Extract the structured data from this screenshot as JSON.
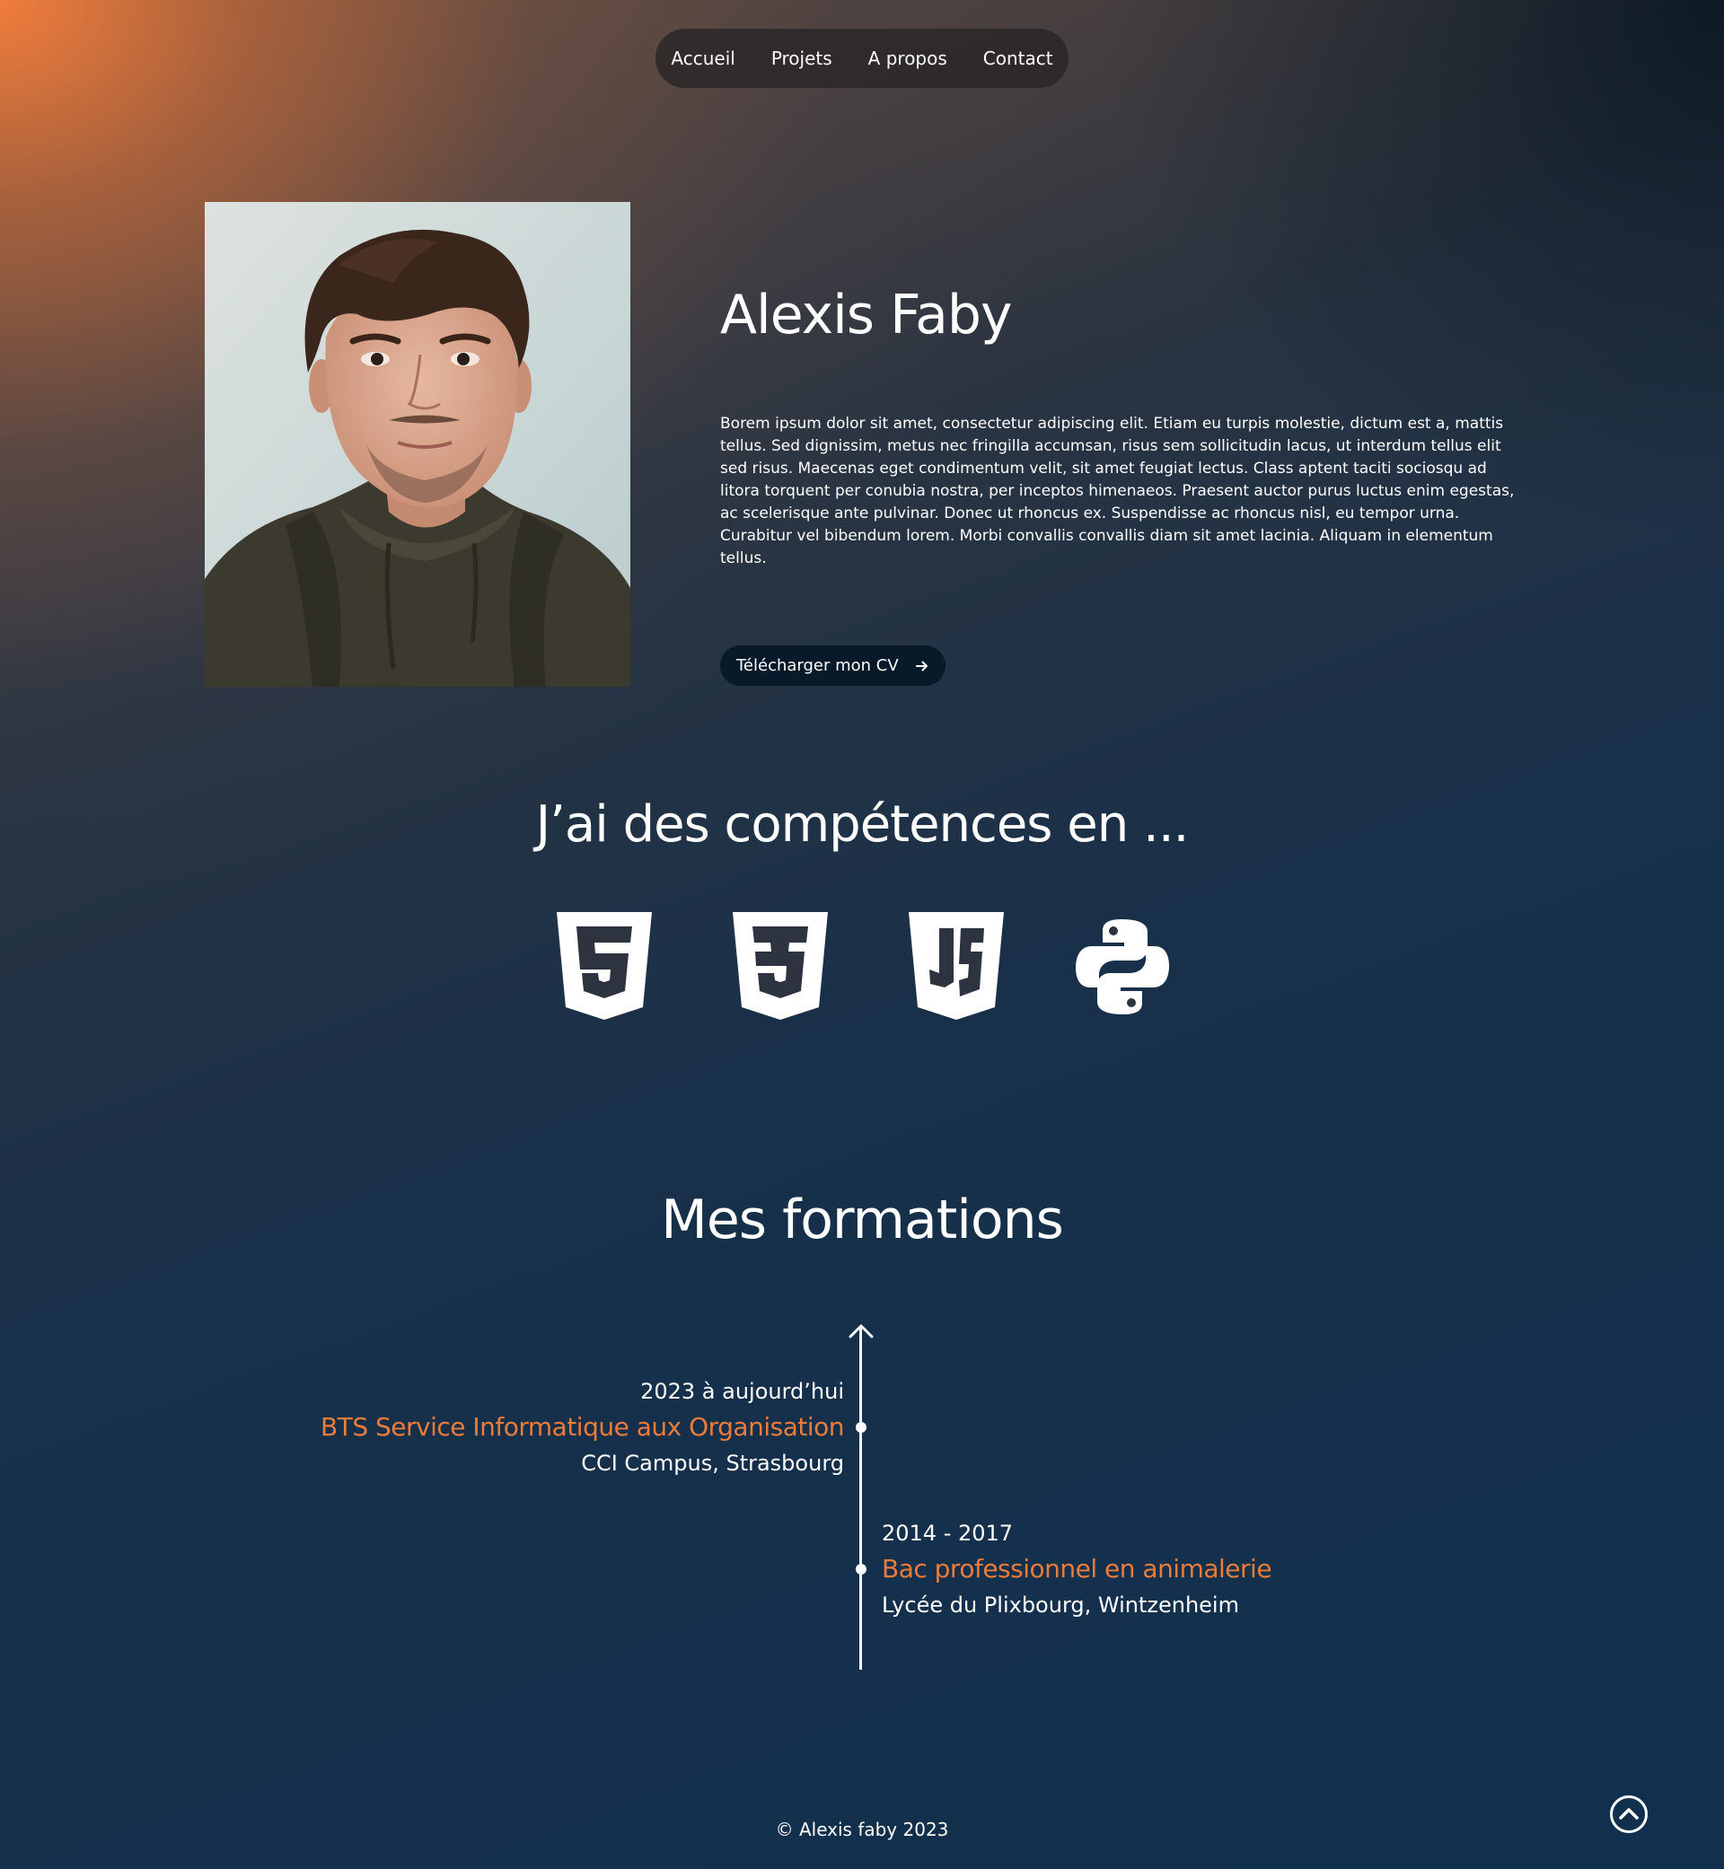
{
  "nav": {
    "items": [
      {
        "label": "Accueil"
      },
      {
        "label": "Projets"
      },
      {
        "label": "A propos"
      },
      {
        "label": "Contact"
      }
    ]
  },
  "hero": {
    "name": "Alexis Faby",
    "bio": "Borem ipsum dolor sit amet, consectetur adipiscing elit. Etiam eu turpis molestie, dictum est a, mattis tellus. Sed dignissim, metus nec fringilla accumsan, risus sem sollicitudin lacus, ut interdum tellus elit sed risus. Maecenas eget condimentum velit, sit amet feugiat lectus. Class aptent taciti sociosqu ad litora torquent per conubia nostra, per inceptos himenaeos. Praesent auctor purus luctus enim egestas, ac scelerisque ante pulvinar. Donec ut rhoncus ex. Suspendisse ac rhoncus nisl, eu tempor urna. Curabitur vel bibendum lorem. Morbi convallis convallis diam sit amet lacinia. Aliquam in elementum tellus.",
    "cv_button_label": "Télécharger mon CV",
    "cv_button_icon": "arrow-right-icon"
  },
  "skills": {
    "title": "J’ai des compétences en ...",
    "icons": [
      "html5-icon",
      "css3-icon",
      "javascript-icon",
      "python-icon"
    ]
  },
  "formations": {
    "title": "Mes formations",
    "items": [
      {
        "date": "2023 à aujourd’hui",
        "title": "BTS Service Informatique aux Organisation",
        "school": "CCI Campus, Strasbourg"
      },
      {
        "date": "2014 - 2017",
        "title": "Bac professionnel en animalerie",
        "school": "Lycée du Plixbourg, Wintzenheim"
      }
    ]
  },
  "footer": {
    "copyright": "© Alexis faby 2023"
  },
  "colors": {
    "accent": "#ec7c3a",
    "button_bg": "#08192a",
    "background_dark": "#10304d"
  }
}
